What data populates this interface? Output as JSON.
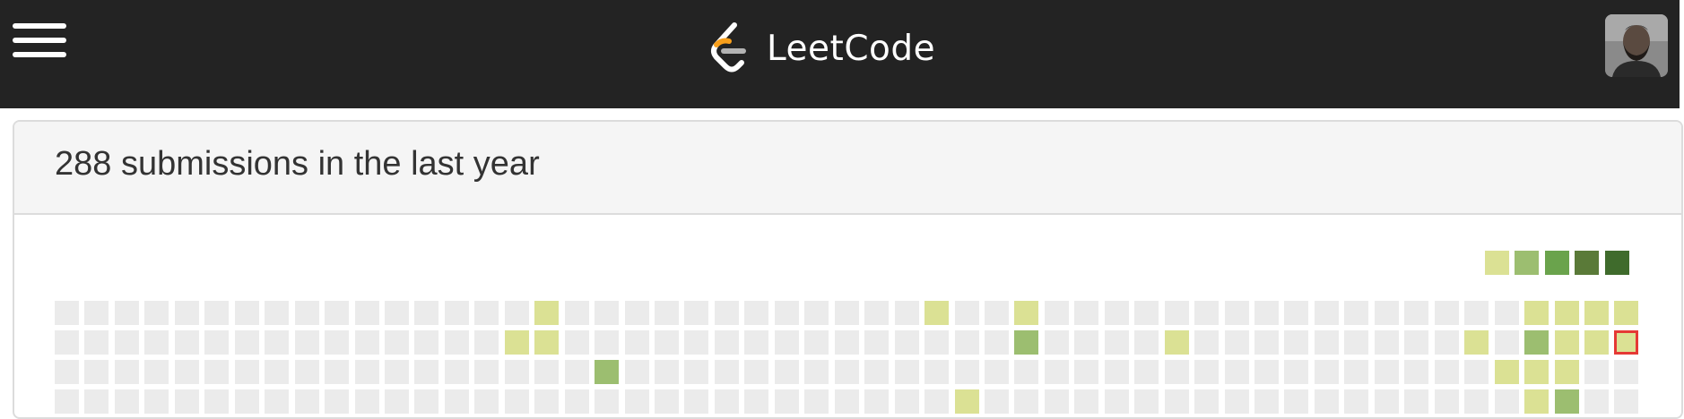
{
  "brand": {
    "name": "LeetCode"
  },
  "navbar": {
    "menu_icon": "hamburger-menu-icon",
    "logo_icon": "leetcode-logo-icon",
    "avatar_icon": "user-avatar"
  },
  "submissions": {
    "title": "288 submissions in the last year"
  },
  "heatmap": {
    "colors": [
      "#ebebeb",
      "#dbe194",
      "#9cbe70",
      "#6aa34c",
      "#5a7a38",
      "#3f6b2c"
    ],
    "legend_levels": [
      1,
      2,
      3,
      4,
      5
    ],
    "columns": 53,
    "visible_rows": 4,
    "today_cell": {
      "row": 1,
      "col": 52
    },
    "active_days": [
      {
        "row": 0,
        "col": 16,
        "level": 1
      },
      {
        "row": 1,
        "col": 15,
        "level": 1
      },
      {
        "row": 1,
        "col": 16,
        "level": 1
      },
      {
        "row": 2,
        "col": 18,
        "level": 2
      },
      {
        "row": 0,
        "col": 29,
        "level": 1
      },
      {
        "row": 3,
        "col": 30,
        "level": 1
      },
      {
        "row": 0,
        "col": 32,
        "level": 1
      },
      {
        "row": 1,
        "col": 32,
        "level": 2
      },
      {
        "row": 1,
        "col": 37,
        "level": 1
      },
      {
        "row": 1,
        "col": 47,
        "level": 1
      },
      {
        "row": 0,
        "col": 49,
        "level": 1
      },
      {
        "row": 1,
        "col": 49,
        "level": 2
      },
      {
        "row": 2,
        "col": 48,
        "level": 1
      },
      {
        "row": 2,
        "col": 49,
        "level": 1
      },
      {
        "row": 3,
        "col": 49,
        "level": 1
      },
      {
        "row": 0,
        "col": 50,
        "level": 1
      },
      {
        "row": 1,
        "col": 50,
        "level": 1
      },
      {
        "row": 2,
        "col": 50,
        "level": 1
      },
      {
        "row": 3,
        "col": 50,
        "level": 2
      },
      {
        "row": 0,
        "col": 51,
        "level": 1
      },
      {
        "row": 1,
        "col": 51,
        "level": 1
      },
      {
        "row": 0,
        "col": 52,
        "level": 1
      },
      {
        "row": 1,
        "col": 52,
        "level": 1
      }
    ]
  }
}
